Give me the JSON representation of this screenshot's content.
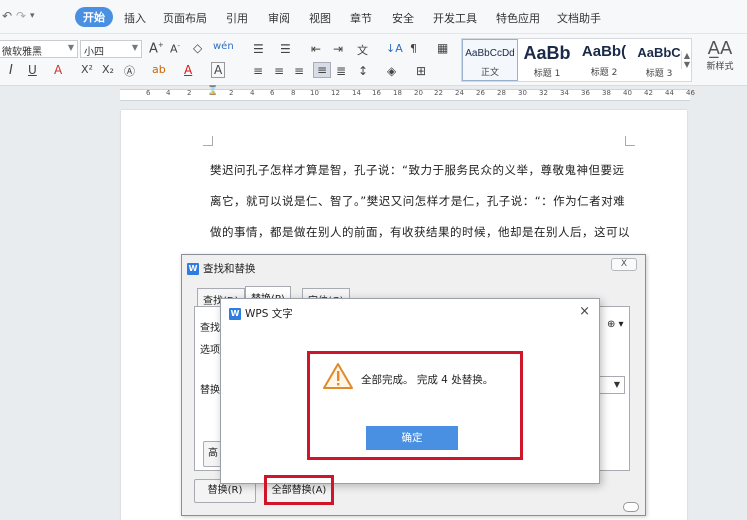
{
  "menubar": {
    "tabs": [
      "开始",
      "插入",
      "页面布局",
      "引用",
      "审阅",
      "视图",
      "章节",
      "安全",
      "开发工具",
      "特色应用",
      "文档助手"
    ],
    "active_tab": "开始"
  },
  "ribbon": {
    "font_name": "微软雅黑",
    "font_size": "小四",
    "styles": [
      {
        "preview": "AaBbCcDd",
        "name": "正文"
      },
      {
        "preview": "AaBb",
        "name": "标题 1"
      },
      {
        "preview": "AaBb(",
        "name": "标题 2"
      },
      {
        "preview": "AaBbC",
        "name": "标题 3"
      }
    ],
    "new_style_label": "新样式"
  },
  "ruler": {
    "numbers": [
      "6",
      "4",
      "2",
      "2",
      "4",
      "6",
      "8",
      "10",
      "12",
      "14",
      "16",
      "18",
      "20",
      "22",
      "24",
      "26",
      "28",
      "30",
      "32",
      "34",
      "36",
      "38",
      "40",
      "42",
      "44",
      "46"
    ]
  },
  "document": {
    "lines": [
      "樊迟问孔子怎样才算是智，孔子说：“致力于服务民众的义举，尊敬鬼神但要远",
      "离它，就可以说是仁、智了。”樊迟又问怎样才是仁，孔子说：“：作为仁者对难",
      "做的事情，都是做在别人的前面，有收获结果的时候，他却是在别人后，这可以"
    ]
  },
  "find_replace": {
    "logo": "W",
    "title": "查找和替换",
    "close": "X",
    "tabs": [
      "查找(D)",
      "替换(P)",
      "定位(G)"
    ],
    "labels": {
      "find": "查找",
      "options": "选项",
      "replace": "替换",
      "advanced": "高"
    },
    "replace_button": "替换(R)",
    "replace_all_button": "全部替换(A)"
  },
  "message": {
    "logo": "W",
    "title": "WPS 文字",
    "close": "×",
    "text": "全部完成。 完成 4 处替换。",
    "ok_button": "确定"
  },
  "colors": {
    "accent": "#4a90e2",
    "highlight": "#d0152a"
  }
}
